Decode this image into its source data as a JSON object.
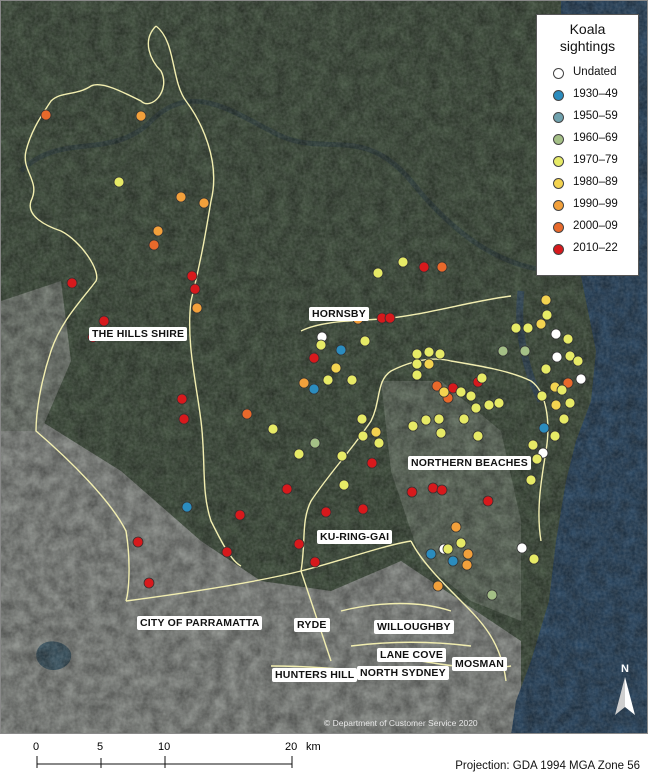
{
  "legend": {
    "title_line1": "Koala",
    "title_line2": "sightings",
    "categories": [
      {
        "label": "Undated",
        "color": "#ffffff"
      },
      {
        "label": "1930–49",
        "color": "#2b8cbe"
      },
      {
        "label": "1950–59",
        "color": "#6fa1ad"
      },
      {
        "label": "1960–69",
        "color": "#a4bf86"
      },
      {
        "label": "1970–79",
        "color": "#e6ea66"
      },
      {
        "label": "1980–89",
        "color": "#f3d350"
      },
      {
        "label": "1990–99",
        "color": "#f2a03b"
      },
      {
        "label": "2000–09",
        "color": "#e8692b"
      },
      {
        "label": "2010–22",
        "color": "#d7191c"
      }
    ]
  },
  "lga_labels": {
    "hills_shire": "THE HILLS SHIRE",
    "hornsby": "HORNSBY",
    "northern_beaches": "NORTHERN BEACHES",
    "ku_ring_gai": "KU-RING-GAI",
    "parramatta": "CITY OF PARRAMATTA",
    "ryde": "RYDE",
    "willoughby": "WILLOUGHBY",
    "lane_cove": "LANE COVE",
    "hunters_hill": "HUNTERS HILL",
    "north_sydney": "NORTH SYDNEY",
    "mosman": "MOSMAN"
  },
  "north_arrow": "N",
  "copyright": "© Department of Customer Service 2020",
  "scale": {
    "ticks": [
      "0",
      "5",
      "10",
      "20"
    ],
    "unit": "km"
  },
  "projection": "Projection: GDA 1994 MGA Zone 56",
  "colors": {
    "forest": "#3d4d3a",
    "urban": "#8d918c",
    "ocean": "#254563",
    "boundary": "#f2eeb0"
  }
}
